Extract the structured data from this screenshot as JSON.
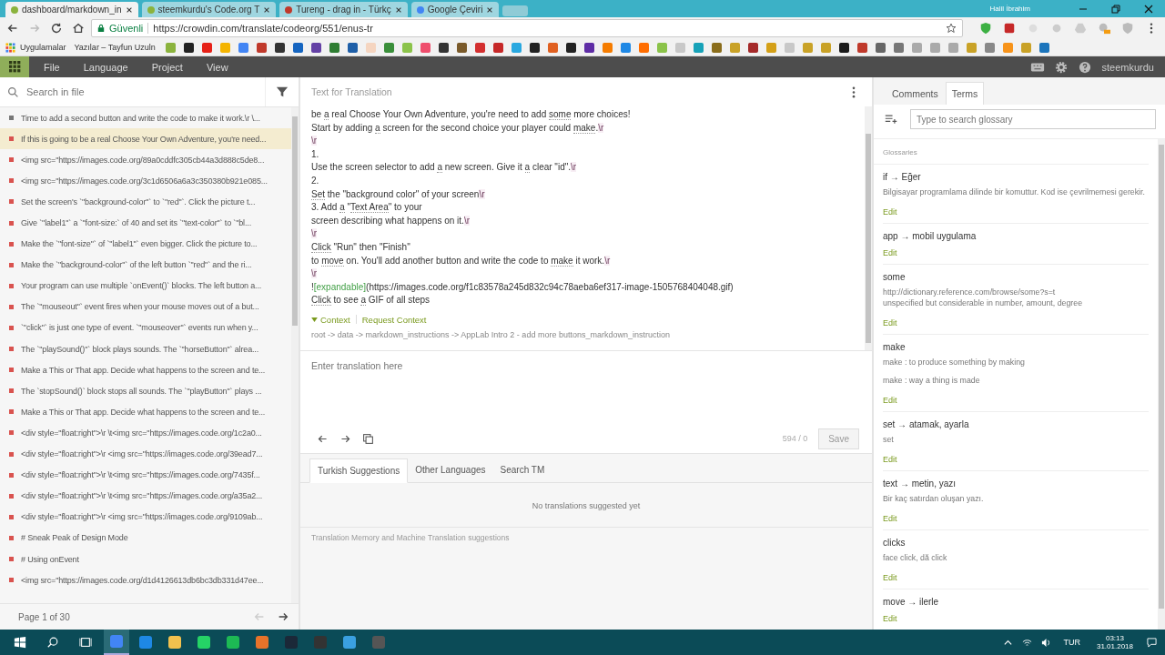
{
  "browser": {
    "tabs": [
      {
        "title": "dashboard/markdown_in",
        "selected": true,
        "color": "#8bb33d"
      },
      {
        "title": "steemkurdu's Code.org T",
        "selected": false,
        "color": "#8bb33d"
      },
      {
        "title": "Tureng - drag in - Türkç",
        "selected": false,
        "color": "#c0392b"
      },
      {
        "title": "Google Çeviri",
        "selected": false,
        "color": "#4285f4"
      }
    ],
    "user": "Halil İbrahim",
    "secure_label": "Güvenli",
    "url": "https://crowdin.com/translate/codeorg/551/enus-tr",
    "bookmarks": [
      {
        "label": "Uygulamalar"
      },
      {
        "label": "Yazılar – Tayfun Uzuln"
      }
    ],
    "bookmark_icons": [
      {
        "color": "#8bb33d"
      },
      {
        "color": "#222222"
      },
      {
        "color": "#e62117"
      },
      {
        "color": "#f4b400"
      },
      {
        "color": "#4285f4"
      },
      {
        "color": "#c0392b"
      },
      {
        "color": "#333333"
      },
      {
        "color": "#1565c0"
      },
      {
        "color": "#6441a5"
      },
      {
        "color": "#2e7d32"
      },
      {
        "color": "#1e5fa8"
      },
      {
        "color": "#f5d5c0"
      },
      {
        "color": "#3a8f3a"
      },
      {
        "color": "#8bc34a"
      },
      {
        "color": "#ef4e6d"
      },
      {
        "color": "#333333"
      },
      {
        "color": "#7a5a2a"
      },
      {
        "color": "#d32f2f"
      },
      {
        "color": "#c62828"
      },
      {
        "color": "#29a8e0"
      },
      {
        "color": "#222222"
      },
      {
        "color": "#e06020"
      },
      {
        "color": "#222222"
      },
      {
        "color": "#5e2ca5"
      },
      {
        "color": "#f57c00"
      },
      {
        "color": "#1e88e5"
      },
      {
        "color": "#ff6d00"
      },
      {
        "color": "#8bc34a"
      },
      {
        "color": "#c8c8c8"
      },
      {
        "color": "#17a2b8"
      },
      {
        "color": "#8a6d1b"
      },
      {
        "color": "#c9a227"
      },
      {
        "color": "#a52a2a"
      },
      {
        "color": "#d4a017"
      },
      {
        "color": "#c8c8c8"
      },
      {
        "color": "#c9a227"
      },
      {
        "color": "#c9a227"
      },
      {
        "color": "#1a1a1a"
      },
      {
        "color": "#c0392b"
      },
      {
        "color": "#666666"
      },
      {
        "color": "#777777"
      },
      {
        "color": "#aaaaaa"
      },
      {
        "color": "#aaaaaa"
      },
      {
        "color": "#aaaaaa"
      },
      {
        "color": "#c9a227"
      },
      {
        "color": "#888888"
      },
      {
        "color": "#f7931a"
      },
      {
        "color": "#c9a227"
      },
      {
        "color": "#1c75bc"
      }
    ]
  },
  "menu": {
    "items": [
      "File",
      "Language",
      "Project",
      "View"
    ],
    "user": "steemkurdu"
  },
  "strings": {
    "search_placeholder": "Search in file",
    "items": [
      {
        "text": "Time to add a second button and write the code to make it work.\\r \\...",
        "color": "#777777",
        "selected": false
      },
      {
        "text": "If this is going to be a real Choose Your Own Adventure, you're need...",
        "color": "#d9534f",
        "selected": true
      },
      {
        "text": "<img src=\"https://images.code.org/89a0cddfc305cb44a3d888c5de8...",
        "color": "#d9534f",
        "selected": false
      },
      {
        "text": "<img src=\"https://images.code.org/3c1d6506a6a3c350380b921e085...",
        "color": "#d9534f",
        "selected": false
      },
      {
        "text": "Set the screen's `\"background-color\"` to `\"red\"`. Click the picture t...",
        "color": "#d9534f",
        "selected": false
      },
      {
        "text": "Give `\"label1\"` a `\"font-size:` of 40 and set its `\"text-color\"` to `\"bl...",
        "color": "#d9534f",
        "selected": false
      },
      {
        "text": "Make the `\"font-size\"` of `\"label1\"` even bigger. Click the picture to...",
        "color": "#d9534f",
        "selected": false
      },
      {
        "text": "Make the `\"background-color\"` of the left button `\"red\"` and the ri...",
        "color": "#d9534f",
        "selected": false
      },
      {
        "text": "Your program can use multiple `onEvent()` blocks. The left button a...",
        "color": "#d9534f",
        "selected": false
      },
      {
        "text": "The `\"mouseout\"` event fires when your mouse moves out of a but...",
        "color": "#d9534f",
        "selected": false
      },
      {
        "text": "`\"click\"` is just one type of event. `\"mouseover\"` events run when y...",
        "color": "#d9534f",
        "selected": false
      },
      {
        "text": "The `\"playSound()\"` block plays sounds. The `\"horseButton\"` alrea...",
        "color": "#d9534f",
        "selected": false
      },
      {
        "text": "Make a This or That app. Decide what happens to the screen and te...",
        "color": "#d9534f",
        "selected": false
      },
      {
        "text": "The `stopSound()` block stops all sounds. The `\"playButton\"` plays ...",
        "color": "#d9534f",
        "selected": false
      },
      {
        "text": "Make a This or That app. Decide what happens to the screen and te...",
        "color": "#d9534f",
        "selected": false
      },
      {
        "text": "<div style=\"float:right\">\\r \\t<img src=\"https://images.code.org/1c2a0...",
        "color": "#d9534f",
        "selected": false
      },
      {
        "text": "<div style=\"float:right\">\\r <img src=\"https://images.code.org/39ead7...",
        "color": "#d9534f",
        "selected": false
      },
      {
        "text": "<div style=\"float:right\">\\r \\t<img src=\"https://images.code.org/7435f...",
        "color": "#d9534f",
        "selected": false
      },
      {
        "text": "<div style=\"float:right\">\\r \\t<img src=\"https://images.code.org/a35a2...",
        "color": "#d9534f",
        "selected": false
      },
      {
        "text": "<div style=\"float:right\">\\r <img src=\"https://images.code.org/9109ab...",
        "color": "#d9534f",
        "selected": false
      },
      {
        "text": "# Sneak Peak of Design Mode",
        "color": "#d9534f",
        "selected": false
      },
      {
        "text": "# Using onEvent",
        "color": "#d9534f",
        "selected": false
      },
      {
        "text": "<img src=\"https://images.code.org/d1d4126613db6bc3db331d47ee...",
        "color": "#d9534f",
        "selected": false
      }
    ],
    "page": "Page 1 of 30"
  },
  "source": {
    "title": "Text for Translation",
    "lines": [
      [
        {
          "kind": "plain",
          "text": "be "
        },
        {
          "kind": "term",
          "text": "a"
        },
        {
          "kind": "plain",
          "text": " real Choose Your Own Adventure, you're need to add "
        },
        {
          "kind": "term",
          "text": "some"
        },
        {
          "kind": "plain",
          "text": " more choices!"
        }
      ],
      [
        {
          "kind": "plain",
          "text": "Start by adding "
        },
        {
          "kind": "term",
          "text": "a"
        },
        {
          "kind": "plain",
          "text": " screen for the second choice your player could "
        },
        {
          "kind": "term",
          "text": "make"
        },
        {
          "kind": "plain",
          "text": "."
        },
        {
          "kind": "escape",
          "text": "\\r"
        }
      ],
      [
        {
          "kind": "escape",
          "text": "\\r"
        }
      ],
      [
        {
          "kind": "plain",
          "text": "1."
        }
      ],
      [
        {
          "kind": "plain",
          "text": "Use the screen selector to add "
        },
        {
          "kind": "term",
          "text": "a"
        },
        {
          "kind": "plain",
          "text": " new screen. Give it "
        },
        {
          "kind": "term",
          "text": "a"
        },
        {
          "kind": "plain",
          "text": " clear \"id\"."
        },
        {
          "kind": "escape",
          "text": "\\r"
        }
      ],
      [
        {
          "kind": "plain",
          "text": "2."
        }
      ],
      [
        {
          "kind": "term",
          "text": "Set"
        },
        {
          "kind": "plain",
          "text": " the \"background color\" of your screen"
        },
        {
          "kind": "escape",
          "text": "\\r"
        }
      ],
      [
        {
          "kind": "plain",
          "text": "3. Add "
        },
        {
          "kind": "term",
          "text": "a"
        },
        {
          "kind": "plain",
          "text": " \""
        },
        {
          "kind": "term",
          "text": "Text Area"
        },
        {
          "kind": "plain",
          "text": "\" to your"
        }
      ],
      [
        {
          "kind": "plain",
          "text": "screen describing what happens on it."
        },
        {
          "kind": "escape",
          "text": "\\r"
        }
      ],
      [
        {
          "kind": "escape",
          "text": "\\r"
        }
      ],
      [
        {
          "kind": "term",
          "text": "Click"
        },
        {
          "kind": "plain",
          "text": " \"Run\" then \"Finish\""
        }
      ],
      [
        {
          "kind": "plain",
          "text": "to "
        },
        {
          "kind": "term",
          "text": "move"
        },
        {
          "kind": "plain",
          "text": " on. You'll add another button and write the code to "
        },
        {
          "kind": "term",
          "text": "make"
        },
        {
          "kind": "plain",
          "text": " it work."
        },
        {
          "kind": "escape",
          "text": "\\r"
        }
      ],
      [
        {
          "kind": "escape",
          "text": "\\r"
        }
      ],
      [
        {
          "kind": "plain",
          "text": "!"
        },
        {
          "kind": "tag",
          "text": "[expandable]"
        },
        {
          "kind": "plain",
          "text": "(https://images.code.org/f1c83578a245d832c94c78aeba6ef317-image-1505768404048.gif)"
        }
      ],
      [
        {
          "kind": "term",
          "text": "Click"
        },
        {
          "kind": "plain",
          "text": " to see "
        },
        {
          "kind": "term",
          "text": "a"
        },
        {
          "kind": "plain",
          "text": " GIF of all steps"
        }
      ]
    ],
    "context_label": "Context",
    "request_context": "Request Context",
    "context_path": "root -> data -> markdown_instructions -> AppLab Intro 2 - add more buttons_markdown_instruction"
  },
  "translation": {
    "placeholder": "Enter translation here",
    "counter": "594 / 0",
    "save": "Save"
  },
  "suggestions": {
    "tabs": [
      {
        "label": "Turkish Suggestions",
        "selected": true
      },
      {
        "label": "Other Languages",
        "selected": false
      },
      {
        "label": "Search TM",
        "selected": false
      }
    ],
    "empty": "No translations suggested yet",
    "footer": "Translation Memory and Machine Translation suggestions"
  },
  "sidebar": {
    "tabs": [
      {
        "label": "Comments",
        "selected": false
      },
      {
        "label": "Terms",
        "selected": true
      }
    ],
    "search_placeholder": "Type to search glossary",
    "section": "Glossaries",
    "terms": [
      {
        "term": "if → Eğer",
        "notes": [
          "Bilgisayar programlama dilinde bir komuttur. Kod ise çevrilmemesi gerekir."
        ],
        "edit": "Edit"
      },
      {
        "term": "app → mobil uygulama",
        "edit": "Edit"
      },
      {
        "term": "some",
        "notes": [
          "http://dictionary.reference.com/browse/some?s=t\nunspecified but considerable in number, amount, degree"
        ],
        "edit": "Edit"
      },
      {
        "term": "make",
        "notes": [
          "make : to produce something by making",
          "make : way a thing is made"
        ],
        "edit": "Edit"
      },
      {
        "term": "set → atamak, ayarla",
        "notes": [
          "set"
        ],
        "edit": "Edit"
      },
      {
        "term": "text → metin, yazı",
        "notes": [
          "Bir kaç satırdan oluşan yazı."
        ],
        "edit": "Edit"
      },
      {
        "term": "clicks",
        "notes": [
          "face click, dă click"
        ],
        "edit": "Edit"
      },
      {
        "term": "move → ilerle",
        "edit": "Edit"
      }
    ]
  },
  "taskbar": {
    "apps": [
      {
        "color": "#4285f4",
        "selected": true
      },
      {
        "color": "#1e88e5",
        "selected": false
      },
      {
        "color": "#f2c14e",
        "selected": false
      },
      {
        "color": "#25d366",
        "selected": false
      },
      {
        "color": "#1db954",
        "selected": false
      },
      {
        "color": "#e8732a",
        "selected": false
      },
      {
        "color": "#1b2838",
        "selected": false
      },
      {
        "color": "#333333",
        "selected": false
      },
      {
        "color": "#3aa0e0",
        "selected": false
      },
      {
        "color": "#555555",
        "selected": false
      }
    ],
    "language": "TUR",
    "time": "03:13",
    "date": "31.01.2018"
  }
}
